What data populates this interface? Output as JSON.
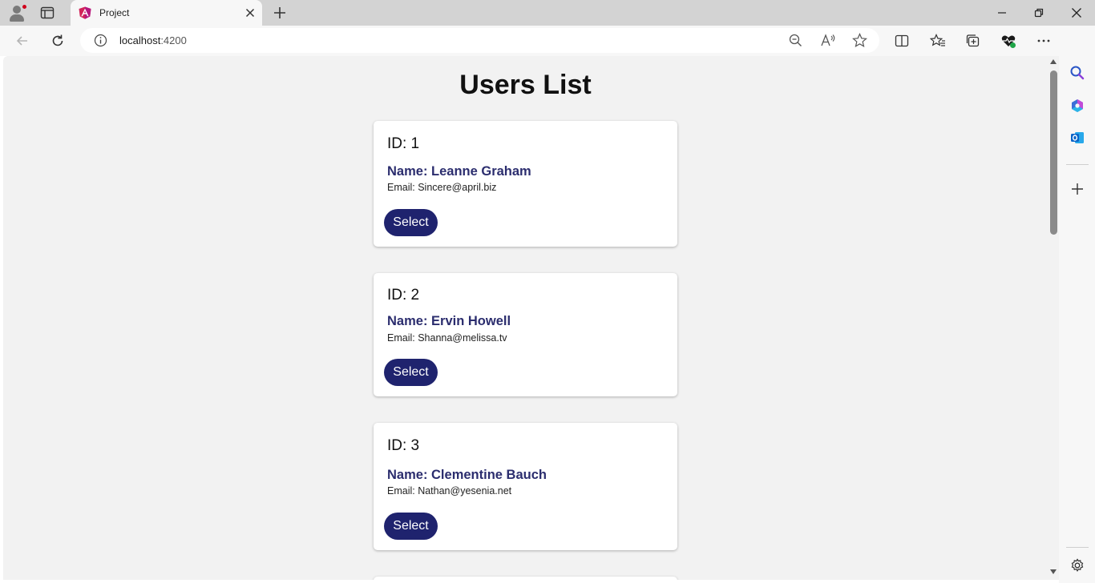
{
  "browser": {
    "tab": {
      "title": "Project",
      "favicon": "angular-logo-icon"
    },
    "address_bar": {
      "host": "localhost",
      "port": ":4200",
      "info_icon": "info-icon"
    },
    "colors": {
      "tabstrip": "#d3d3d3",
      "toolbar": "#f7f7f7",
      "profile_badge": "#d0021b",
      "copilot": "#1a7ee8"
    }
  },
  "page": {
    "title": "Users List",
    "background": "#f2f2f2",
    "accent": "#1f236e",
    "name_color": "#2b2d6e",
    "users": [
      {
        "id_label": "ID: 1",
        "name_label": "Name: Leanne Graham",
        "email_label": "Email: Sincere@april.biz",
        "button": "Select"
      },
      {
        "id_label": "ID: 2",
        "name_label": "Name: Ervin Howell",
        "email_label": "Email: Shanna@melissa.tv",
        "button": "Select"
      },
      {
        "id_label": "ID: 3",
        "name_label": "Name: Clementine Bauch",
        "email_label": "Email: Nathan@yesenia.net",
        "button": "Select"
      }
    ]
  }
}
